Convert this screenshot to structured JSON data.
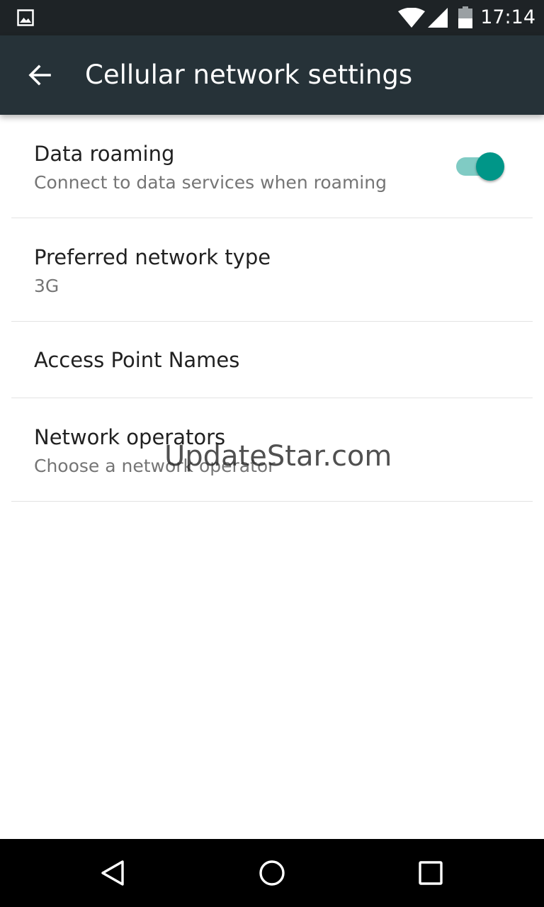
{
  "status_bar": {
    "time": "17:14",
    "icons": [
      "photo-notification-icon",
      "wifi-icon",
      "cell-signal-icon",
      "battery-icon"
    ]
  },
  "app_bar": {
    "title": "Cellular network settings",
    "back_icon": "arrow-back-icon"
  },
  "settings": {
    "items": [
      {
        "title": "Data roaming",
        "summary": "Connect to data services when roaming",
        "toggle_on": true
      },
      {
        "title": "Preferred network type",
        "summary": "3G"
      },
      {
        "title": "Access Point Names"
      },
      {
        "title": "Network operators",
        "summary": "Choose a network operator"
      }
    ]
  },
  "watermark": "UpdateStar.com",
  "nav_bar": {
    "icons": [
      "back-triangle-icon",
      "home-circle-icon",
      "recents-square-icon"
    ]
  },
  "colors": {
    "status_bar": "#1e2326",
    "app_bar": "#263238",
    "accent": "#009688",
    "accent_track": "#80cbc4"
  }
}
